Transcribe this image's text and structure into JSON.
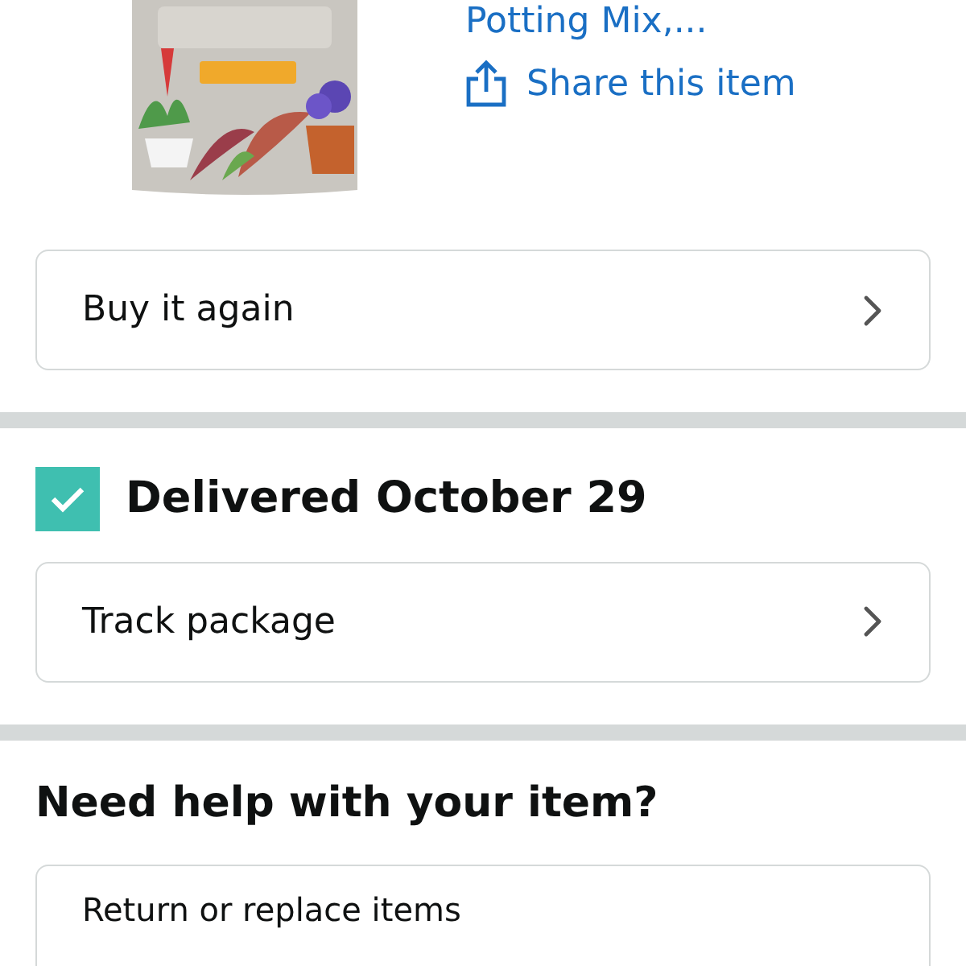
{
  "product": {
    "title_link": "Potting Mix,...",
    "share_link": "Share this item"
  },
  "buy_again": {
    "label": "Buy it again"
  },
  "delivery": {
    "checked": true,
    "status": "Delivered October 29",
    "track_button": "Track package"
  },
  "help": {
    "heading": "Need help with your item?",
    "buttons": [
      "Return or replace items"
    ]
  }
}
